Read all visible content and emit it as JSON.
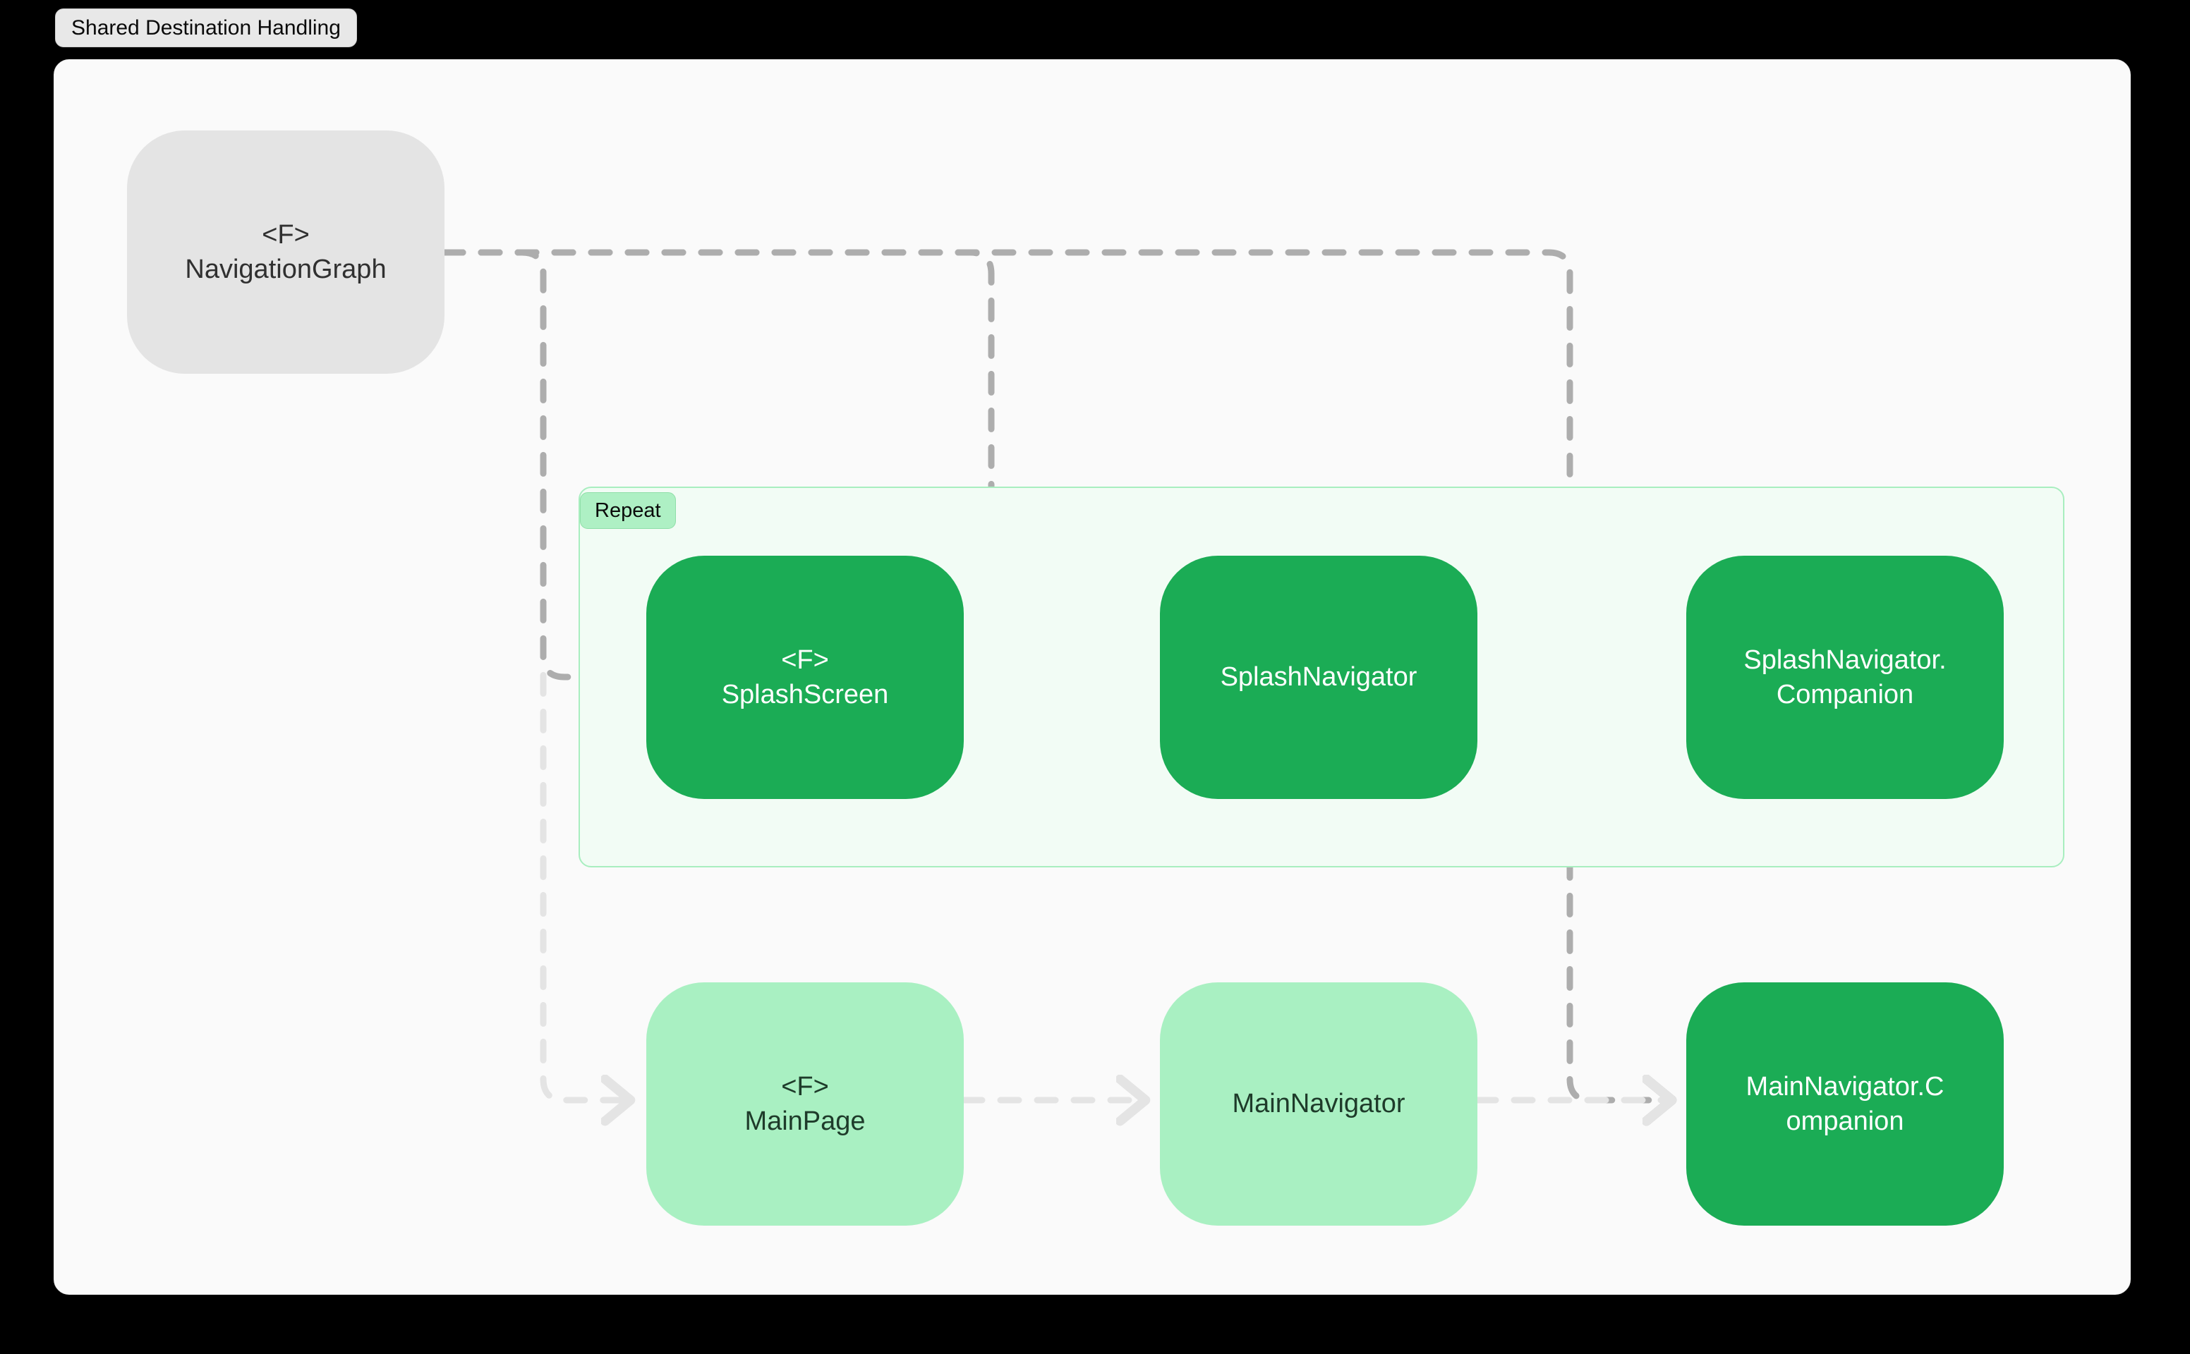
{
  "title": {
    "label": "Shared Destination Handling"
  },
  "group": {
    "label": "Repeat"
  },
  "nodes": [
    {
      "id": "navigation-graph",
      "tag": "<F>",
      "label": "NavigationGraph",
      "style": "grey"
    },
    {
      "id": "splash-screen",
      "tag": "<F>",
      "label": "SplashScreen",
      "style": "green"
    },
    {
      "id": "splash-navigator",
      "tag": "",
      "label": "SplashNavigator",
      "style": "green"
    },
    {
      "id": "splash-companion",
      "tag": "",
      "label": "SplashNavigator.\nCompanion",
      "style": "green"
    },
    {
      "id": "main-page",
      "tag": "<F>",
      "label": "MainPage",
      "style": "lightgreen"
    },
    {
      "id": "main-navigator",
      "tag": "",
      "label": "MainNavigator",
      "style": "lightgreen"
    },
    {
      "id": "main-companion",
      "tag": "",
      "label": "MainNavigator.C\nompanion",
      "style": "green"
    }
  ],
  "edges": [
    {
      "from": "navigation-graph",
      "to": "splash-screen",
      "state": "active"
    },
    {
      "from": "navigation-graph",
      "to": "splash-navigator",
      "state": "active"
    },
    {
      "from": "navigation-graph",
      "to": "main-companion",
      "state": "active"
    },
    {
      "from": "navigation-graph",
      "to": "main-page",
      "state": "faded"
    },
    {
      "from": "splash-screen",
      "to": "splash-navigator",
      "state": "active"
    },
    {
      "from": "splash-navigator",
      "to": "splash-companion",
      "state": "active"
    },
    {
      "from": "main-page",
      "to": "main-navigator",
      "state": "faded"
    },
    {
      "from": "main-navigator",
      "to": "main-companion",
      "state": "faded"
    }
  ],
  "colors": {
    "canvas": "#000000",
    "frame_bg": "#FAFAFA",
    "node_grey": "#E4E4E4",
    "node_green": "#1BAC55",
    "node_light_green": "#A9F0C2",
    "group_bg": "#F2FCF5",
    "group_border": "#A8EEBF",
    "group_chip": "#AEF0C4",
    "edge_active": "#ADADAD",
    "edge_faded": "#E4E4E4",
    "title_chip": "#E8E8E8"
  }
}
